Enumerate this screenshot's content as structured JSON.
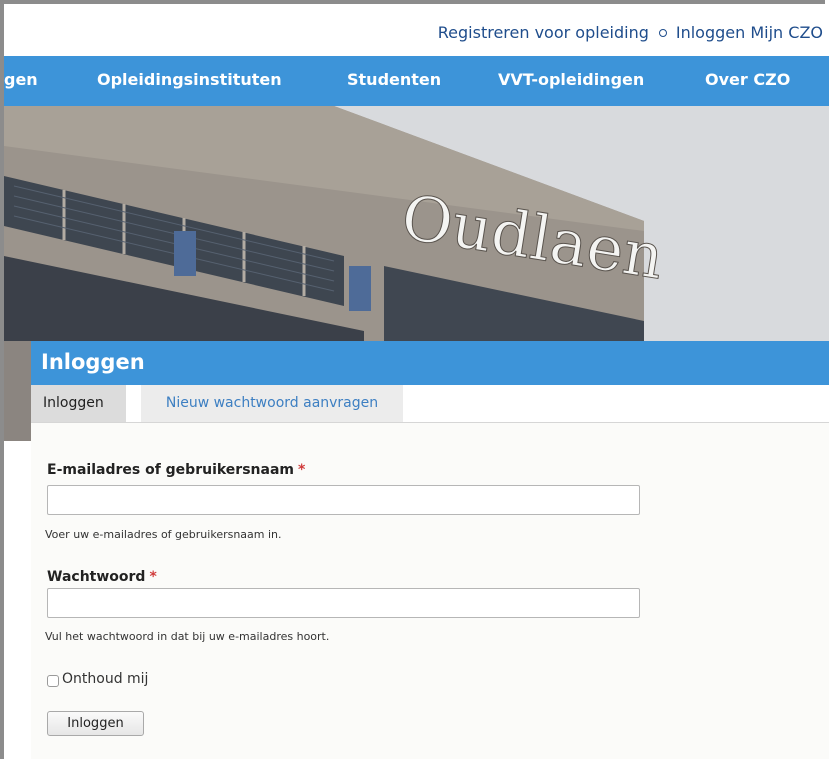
{
  "utility_links": {
    "register": "Registreren voor opleiding",
    "login": "Inloggen Mijn CZO"
  },
  "main_nav": [
    {
      "label": "gen"
    },
    {
      "label": "Opleidingsinstituten"
    },
    {
      "label": "Studenten"
    },
    {
      "label": "VVT-opleidingen"
    },
    {
      "label": "Over CZO"
    }
  ],
  "hero": {
    "building_sign": "Oudlaen"
  },
  "login_panel": {
    "title": "Inloggen",
    "tabs": [
      {
        "label": "Inloggen",
        "active": true
      },
      {
        "label": "Nieuw wachtwoord aanvragen",
        "active": false
      }
    ],
    "username": {
      "label": "E-mailadres of gebruikersnaam",
      "required_marker": "*",
      "value": "",
      "help": "Voer uw e-mailadres of gebruikersnaam in."
    },
    "password": {
      "label": "Wachtwoord",
      "required_marker": "*",
      "value": "",
      "help": "Vul het wachtwoord in dat bij uw e-mailadres hoort."
    },
    "remember": {
      "label": "Onthoud mij",
      "checked": false
    },
    "submit_label": "Inloggen"
  },
  "colors": {
    "nav_blue": "#3d94d9",
    "link_blue": "#1f4d8c",
    "required_red": "#d03b3b"
  }
}
